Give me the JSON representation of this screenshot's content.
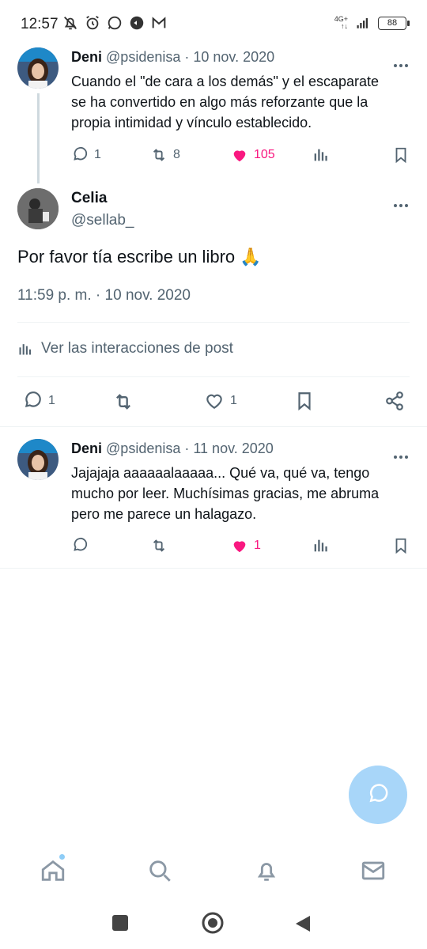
{
  "status_bar": {
    "time": "12:57",
    "network": "4G+",
    "battery": "88"
  },
  "parent_tweet": {
    "name": "Deni",
    "handle": "@psidenisa",
    "date": "· 10 nov. 2020",
    "lines": [
      "Cuando el \"de cara a los demás\" y el escaparate",
      "se ha convertido en algo más reforzante que la",
      "propia intimidad y vínculo establecido."
    ],
    "replies": "1",
    "retweets": "8",
    "likes": "105"
  },
  "main_tweet": {
    "name": "Celia",
    "handle": "@sellab_",
    "text": "Por favor tía escribe un libro 🙏",
    "timestamp": "11:59 p. m. · 10 nov. 2020",
    "insights_label": "Ver las interacciones de post",
    "replies": "1",
    "likes": "1"
  },
  "reply_tweet": {
    "name": "Deni",
    "handle": "@psidenisa",
    "date": "· 11 nov. 2020",
    "lines": [
      "Jajajaja aaaaaalaaaaa... Qué va, qué va, tengo",
      "mucho por leer. Muchísimas gracias, me abruma",
      "pero me parece un halagazo."
    ],
    "likes": "1"
  },
  "colors": {
    "like_pink": "#f91880",
    "muted": "#536471",
    "fab": "#a8d6f9"
  }
}
